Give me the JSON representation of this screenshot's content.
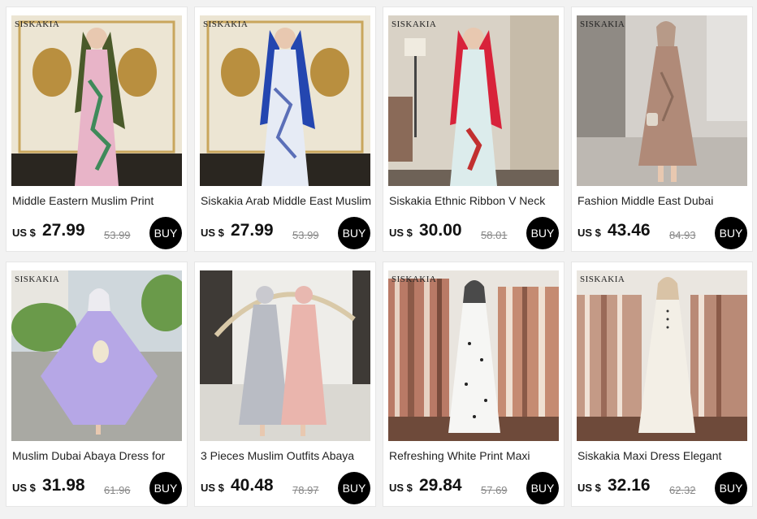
{
  "products": [
    {
      "brand": "SISKAKIA",
      "title": "Middle Eastern Muslim Print",
      "currency": "US $",
      "price": "27.99",
      "old_price": "53.99",
      "buy_label": "BUY"
    },
    {
      "brand": "SISKAKIA",
      "title": "Siskakia Arab Middle East Muslim",
      "currency": "US $",
      "price": "27.99",
      "old_price": "53.99",
      "buy_label": "BUY"
    },
    {
      "brand": "SISKAKIA",
      "title": "Siskakia Ethnic Ribbon V Neck",
      "currency": "US $",
      "price": "30.00",
      "old_price": "58.01",
      "buy_label": "BUY"
    },
    {
      "brand": "SISKAKIA",
      "title": "Fashion Middle East Dubai",
      "currency": "US $",
      "price": "43.46",
      "old_price": "84.93",
      "buy_label": "BUY"
    },
    {
      "brand": "SISKAKIA",
      "title": "Muslim Dubai Abaya Dress for",
      "currency": "US $",
      "price": "31.98",
      "old_price": "61.96",
      "buy_label": "BUY"
    },
    {
      "brand": "",
      "title": "3 Pieces Muslim Outfits Abaya",
      "currency": "US $",
      "price": "40.48",
      "old_price": "78.97",
      "buy_label": "BUY"
    },
    {
      "brand": "SISKAKIA",
      "title": "Refreshing White Print Maxi",
      "currency": "US $",
      "price": "29.84",
      "old_price": "57.69",
      "buy_label": "BUY"
    },
    {
      "brand": "SISKAKIA",
      "title": "Siskakia Maxi Dress Elegant",
      "currency": "US $",
      "price": "32.16",
      "old_price": "62.32",
      "buy_label": "BUY"
    }
  ],
  "colors": {
    "page_background": "#f2f2f2",
    "card_background": "#ffffff",
    "buy_button": "#000000",
    "old_price": "#888888"
  }
}
